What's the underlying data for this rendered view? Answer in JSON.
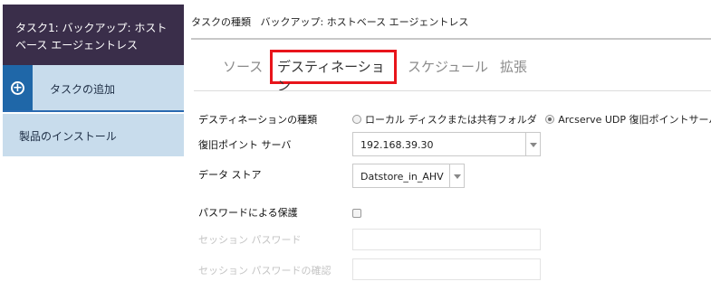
{
  "sidebar": {
    "task_title": "タスク1: バックアップ: ホストベース エージェントレス",
    "add_task_label": "タスクの追加",
    "install_label": "製品のインストール"
  },
  "header": {
    "task_type_label": "タスクの種類",
    "task_type_value": "バックアップ: ホストベース エージェントレス"
  },
  "tabs": [
    {
      "label": "ソース",
      "active": false
    },
    {
      "label": "デスティネーション",
      "active": true
    },
    {
      "label": "スケジュール",
      "active": false
    },
    {
      "label": "拡張",
      "active": false
    }
  ],
  "form": {
    "destination_type_label": "デスティネーションの種類",
    "destination_options": [
      {
        "label": "ローカル ディスクまたは共有フォルダ",
        "selected": false
      },
      {
        "label": "Arcserve UDP 復旧ポイントサーバ",
        "selected": true
      }
    ],
    "rps_label": "復旧ポイント サーバ",
    "rps_value": "192.168.39.30",
    "datastore_label": "データ ストア",
    "datastore_value": "Datstore_in_AHV",
    "password_protect_label": "パスワードによる保護",
    "password_protect_checked": false,
    "session_password_label": "セッション パスワード",
    "session_password_confirm_label": "セッション パスワードの確認"
  },
  "colors": {
    "task_header_bg": "#3a2e4a",
    "nav_bg": "#c8dcec",
    "nav_accent": "#1f67a8",
    "active_tab_border": "#e8151b"
  }
}
